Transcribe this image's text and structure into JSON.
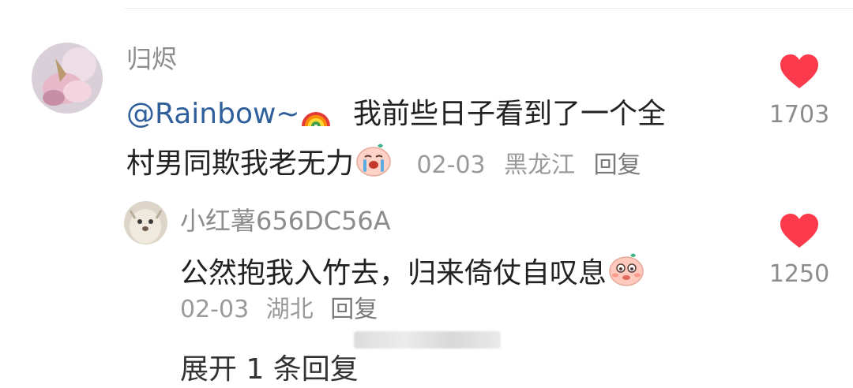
{
  "comments": [
    {
      "username": "归烬",
      "mention": "@Rainbow~",
      "mention_emoji": "rainbow-emoji",
      "text_line1": "我前些日子看到了一个全",
      "text_line2": "村男同欺我老无力",
      "inline_emoji": "crying-face-emoji",
      "date": "02-03",
      "location": "黑龙江",
      "reply_label": "回复",
      "likes": "1703",
      "like_icon": "heart-icon",
      "like_color": "#fb3b4c"
    },
    {
      "username": "小红薯656DC56A",
      "text": "公然抱我入竹去，归来倚仗自叹息",
      "inline_emoji": "shy-face-emoji",
      "date": "02-03",
      "location": "湖北",
      "reply_label": "回复",
      "likes": "1250",
      "like_icon": "heart-icon",
      "like_color": "#fb3b4c"
    }
  ],
  "next_partial_text": "展开 1 条回复"
}
